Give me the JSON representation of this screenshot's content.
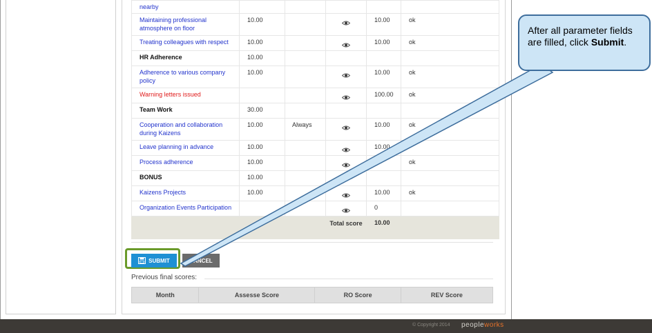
{
  "table": {
    "rows": [
      {
        "name": "nearby",
        "weight": "",
        "freq": "",
        "eye": false,
        "score": "",
        "rem": "",
        "kind": "item"
      },
      {
        "name": "Maintaining professional atmosphere on floor",
        "weight": "10.00",
        "freq": "",
        "eye": true,
        "score": "10.00",
        "rem": "ok",
        "kind": "item"
      },
      {
        "name": "Treating colleagues with respect",
        "weight": "10.00",
        "freq": "",
        "eye": true,
        "score": "10.00",
        "rem": "ok",
        "kind": "item"
      },
      {
        "name": "HR Adherence",
        "weight": "10.00",
        "freq": "",
        "eye": false,
        "score": "",
        "rem": "",
        "kind": "group"
      },
      {
        "name": "Adherence to various company policy",
        "weight": "10.00",
        "freq": "",
        "eye": true,
        "score": "10.00",
        "rem": "ok",
        "kind": "item"
      },
      {
        "name": "Warning letters issued",
        "weight": "",
        "freq": "",
        "eye": true,
        "score": "100.00",
        "rem": "ok",
        "kind": "warn"
      },
      {
        "name": "Team Work",
        "weight": "30.00",
        "freq": "",
        "eye": false,
        "score": "",
        "rem": "",
        "kind": "group"
      },
      {
        "name": "Cooperation and collaboration during Kaizens",
        "weight": "10.00",
        "freq": "Always",
        "eye": true,
        "score": "10.00",
        "rem": "ok",
        "kind": "item"
      },
      {
        "name": "Leave planning in advance",
        "weight": "10.00",
        "freq": "",
        "eye": true,
        "score": "10.00",
        "rem": "",
        "kind": "item"
      },
      {
        "name": "Process adherence",
        "weight": "10.00",
        "freq": "",
        "eye": true,
        "score": "",
        "rem": "ok",
        "kind": "item"
      },
      {
        "name": "BONUS",
        "weight": "10.00",
        "freq": "",
        "eye": false,
        "score": "",
        "rem": "",
        "kind": "group"
      },
      {
        "name": "Kaizens Projects",
        "weight": "10.00",
        "freq": "",
        "eye": true,
        "score": "10.00",
        "rem": "ok",
        "kind": "item"
      },
      {
        "name": "Organization Events Participation",
        "weight": "",
        "freq": "",
        "eye": true,
        "score": "0",
        "rem": "",
        "kind": "item"
      }
    ],
    "total_label": "Total score",
    "total_value": "10.00"
  },
  "actions": {
    "submit_label": "SUBMIT",
    "cancel_label": "CANCEL"
  },
  "previous": {
    "label": "Previous final scores:",
    "columns": [
      "Month",
      "Assesse Score",
      "RO Score",
      "REV Score"
    ]
  },
  "footer": {
    "copyright": "© Copyright 2014",
    "logo_main": "people",
    "logo_accent": "works"
  },
  "callout": {
    "text_before": "After all parameter fields are filled, click ",
    "text_bold": "Submit",
    "text_after": "."
  },
  "colors": {
    "link": "#2233cc",
    "warning": "#e01b1b",
    "submit": "#1e90d4",
    "highlight": "#6a9a2a",
    "callout_bg": "#cde5f6"
  },
  "icons": {
    "view": "eye-icon",
    "submit": "save-icon"
  }
}
